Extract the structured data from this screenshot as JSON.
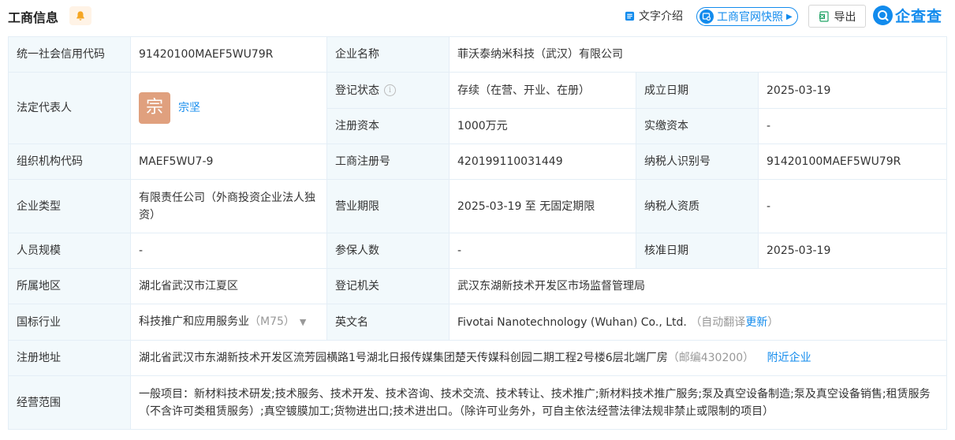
{
  "header": {
    "title": "工商信息",
    "wenzi_label": "文字介绍",
    "kuaizhao_label": "工商官网快照",
    "export_label": "导出",
    "logo_text": "企查查"
  },
  "colors": {
    "accent": "#128bed",
    "label_bg": "#f2f9fc",
    "avatar_bg": "#e0a07e"
  },
  "rows": {
    "credit_code_label": "统一社会信用代码",
    "credit_code": "91420100MAEF5WU79R",
    "company_name_label": "企业名称",
    "company_name": "菲沃泰纳米科技（武汉）有限公司",
    "legal_rep_label": "法定代表人",
    "legal_rep_avatar": "宗",
    "legal_rep_name": "宗坚",
    "reg_status_label": "登记状态",
    "reg_status": "存续（在营、开业、在册）",
    "established_label": "成立日期",
    "established": "2025-03-19",
    "reg_capital_label": "注册资本",
    "reg_capital": "1000万元",
    "paid_capital_label": "实缴资本",
    "paid_capital": "-",
    "org_code_label": "组织机构代码",
    "org_code": "MAEF5WU7-9",
    "biz_reg_no_label": "工商注册号",
    "biz_reg_no": "420199110031449",
    "taxpayer_id_label": "纳税人识别号",
    "taxpayer_id": "91420100MAEF5WU79R",
    "company_type_label": "企业类型",
    "company_type": "有限责任公司（外商投资企业法人独资）",
    "biz_term_label": "营业期限",
    "biz_term": "2025-03-19 至 无固定期限",
    "taxpayer_qual_label": "纳税人资质",
    "taxpayer_qual": "-",
    "staff_size_label": "人员规模",
    "staff_size": "-",
    "insured_label": "参保人数",
    "insured": "-",
    "approved_label": "核准日期",
    "approved": "2025-03-19",
    "region_label": "所属地区",
    "region": "湖北省武汉市江夏区",
    "authority_label": "登记机关",
    "authority": "武汉东湖新技术开发区市场监督管理局",
    "industry_label": "国标行业",
    "industry": "科技推广和应用服务业",
    "industry_code": "（M75）",
    "english_name_label": "英文名",
    "english_name": "Fivotai Nanotechnology (Wuhan) Co., Ltd.",
    "auto_translate": "（自动翻译",
    "update_link": "更新",
    "auto_translate_close": "）",
    "address_label": "注册地址",
    "address": "湖北省武汉市东湖新技术开发区流芳园横路1号湖北日报传媒集团楚天传媒科创园二期工程2号楼6层北端厂房",
    "postcode": "（邮编430200）",
    "nearby_link": "附近企业",
    "scope_label": "经营范围",
    "scope": "一般项目：新材料技术研发;技术服务、技术开发、技术咨询、技术交流、技术转让、技术推广;新材料技术推广服务;泵及真空设备制造;泵及真空设备销售;租赁服务（不含许可类租赁服务）;真空镀膜加工;货物进出口;技术进出口。（除许可业务外，可自主依法经营法律法规非禁止或限制的项目）"
  }
}
